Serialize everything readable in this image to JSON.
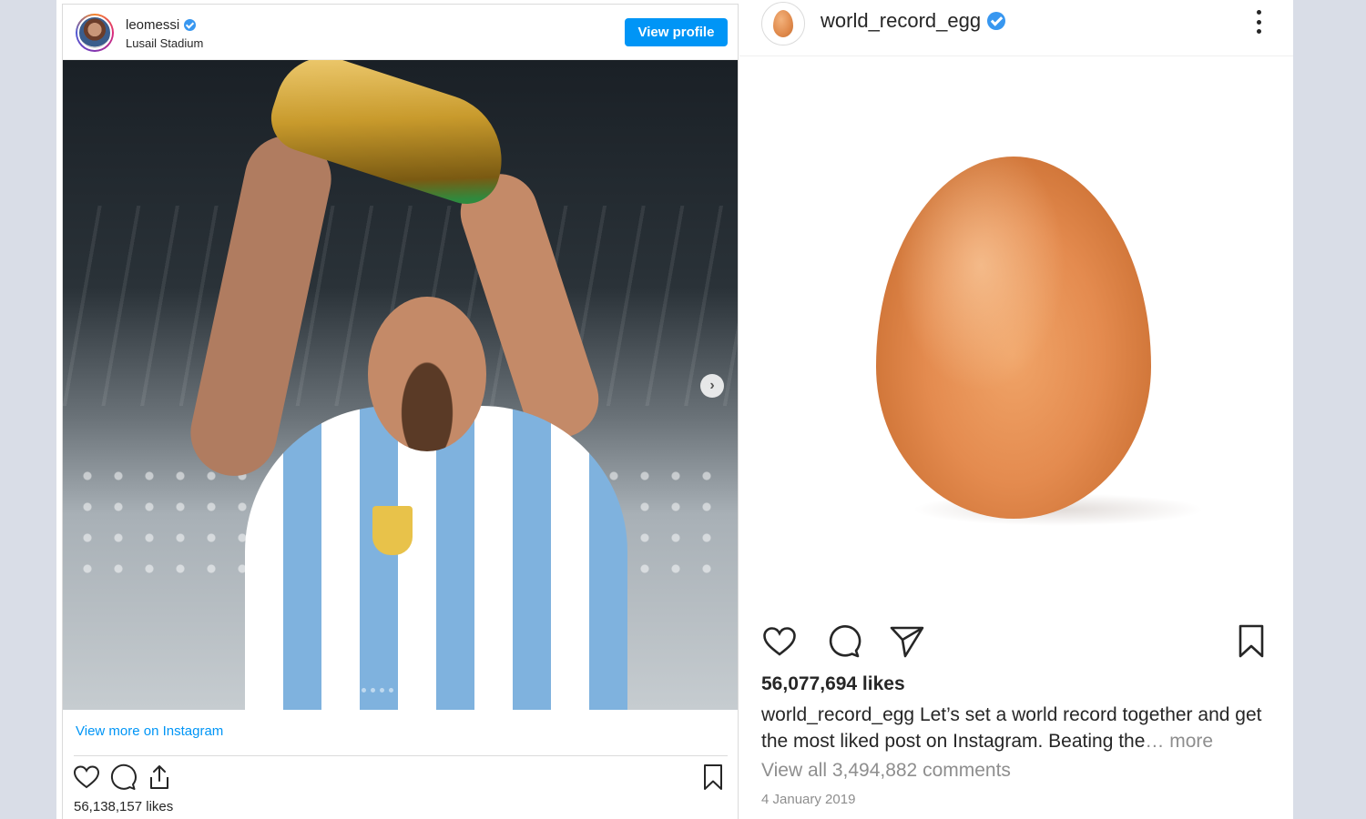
{
  "left_post": {
    "username": "leomessi",
    "location": "Lusail Stadium",
    "view_profile_label": "View profile",
    "view_more_label": "View more on Instagram",
    "likes": "56,138,157 likes",
    "carousel_dots": 7
  },
  "right_post": {
    "username": "world_record_egg",
    "likes": "56,077,694 likes",
    "caption_user": "world_record_egg",
    "caption_text": " Let’s set a world record together and get the most liked post on Instagram. Beating the",
    "caption_more": "… more",
    "comments_link": "View all 3,494,882 comments",
    "date": "4 January 2019"
  },
  "colors": {
    "accent": "#0095f6",
    "verified": "#3897f0",
    "text": "#262626",
    "muted": "#8e8e8e"
  }
}
